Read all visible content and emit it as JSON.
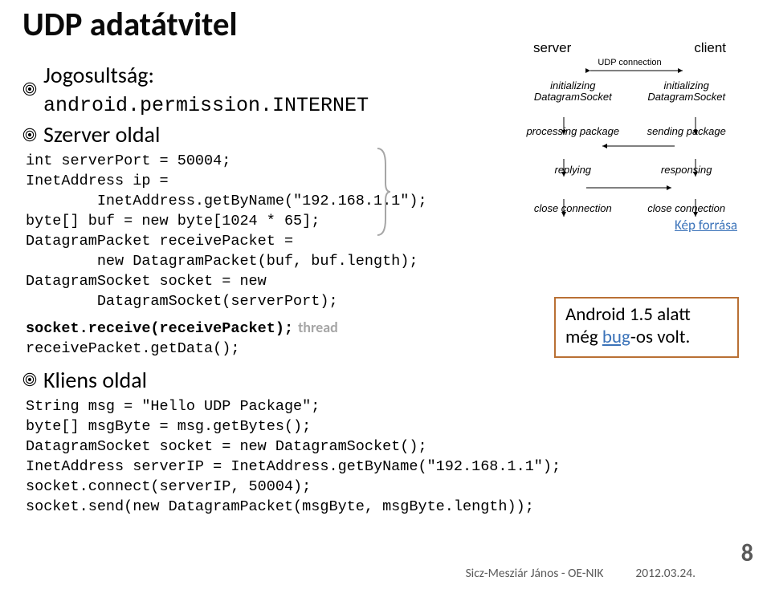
{
  "title": "UDP adatátvitel",
  "bullet1_prefix": "Jogosultság: ",
  "bullet1_perm": "android.permission.INTERNET",
  "bullet2": "Szerver oldal",
  "code_server": "int serverPort = 50004;\nInetAddress ip =\n        InetAddress.getByName(\"192.168.1.1\");\nbyte[] buf = new byte[1024 * 65];\nDatagramPacket receivePacket =\n        new DatagramPacket(buf, buf.length);\nDatagramSocket socket = new\n        DatagramSocket(serverPort);",
  "code_server_bold": "socket.receive(receivePacket);",
  "code_server_end": "receivePacket.getData();",
  "thread_label": "thread",
  "bullet3": "Kliens oldal",
  "code_client": "String msg = \"Hello UDP Package\";\nbyte[] msgByte = msg.getBytes();\nDatagramSocket socket = new DatagramSocket();\nInetAddress serverIP = InetAddress.getByName(\"192.168.1.1\");\nsocket.connect(serverIP, 50004);\nsocket.send(new DatagramPacket(msgByte, msgByte.length));",
  "kep_link": "Kép forrása",
  "android_box_1": "Android 1.5 alatt",
  "android_box_2a": "még ",
  "android_box_bug": "bug",
  "android_box_2b": "-os volt.",
  "footer_author": "Sicz-Mesziár János - OE-NIK",
  "footer_date": "2012.03.24.",
  "page_number": "8",
  "diagram": {
    "server": "server",
    "client": "client",
    "udp": "UDP connection",
    "init_ds": "initializing\nDatagramSocket",
    "proc_pkg": "processing package",
    "send_pkg": "sending package",
    "replying": "replying",
    "responsing": "responsing",
    "close_conn": "close connection"
  }
}
